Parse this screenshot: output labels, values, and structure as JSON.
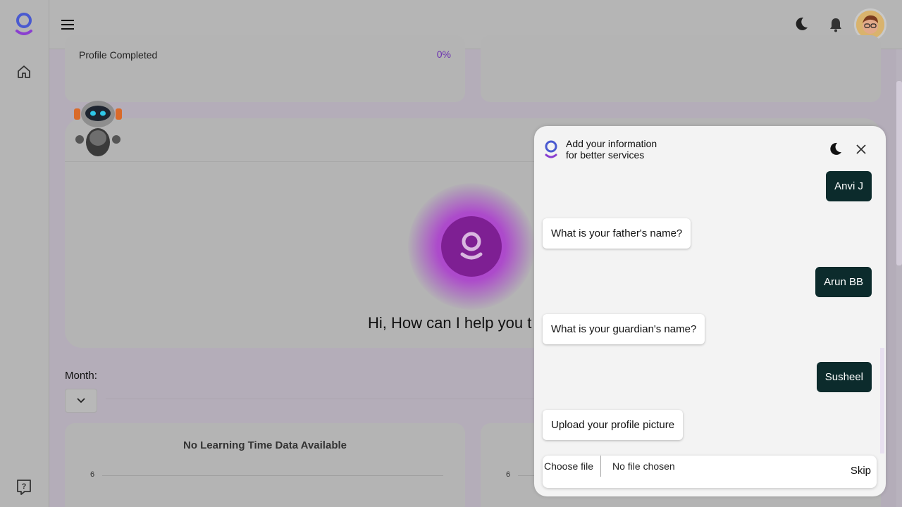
{
  "topbar": {
    "menu_icon": "menu-icon",
    "theme_icon": "moon-icon",
    "notifications_icon": "bell-icon"
  },
  "sidebar": {
    "home_icon": "home-icon",
    "help_icon": "help-icon"
  },
  "profile": {
    "label": "Profile Completed",
    "percent": "0%"
  },
  "assistant": {
    "greeting": "Hi, How can I help you t"
  },
  "filters": {
    "month_label": "Month:"
  },
  "charts": [
    {
      "title": "No Learning Time Data Available",
      "y_tick": "6"
    },
    {
      "title": "",
      "y_tick": "6"
    }
  ],
  "chat": {
    "title_line1": "Add your information",
    "title_line2": "for better services",
    "messages": [
      {
        "role": "user",
        "text": "Anvi J"
      },
      {
        "role": "bot",
        "text": "What is your father's name?"
      },
      {
        "role": "user",
        "text": "Arun BB"
      },
      {
        "role": "bot",
        "text": "What is your guardian's name?"
      },
      {
        "role": "user",
        "text": "Susheel"
      },
      {
        "role": "bot",
        "text": "Upload your profile picture"
      }
    ],
    "choose_file": "Choose file",
    "file_status": "No file chosen",
    "skip": "Skip"
  },
  "colors": {
    "accent": "#6a2fb0",
    "user_bubble": "#0c2b2c",
    "orb": "#7e1f93"
  }
}
